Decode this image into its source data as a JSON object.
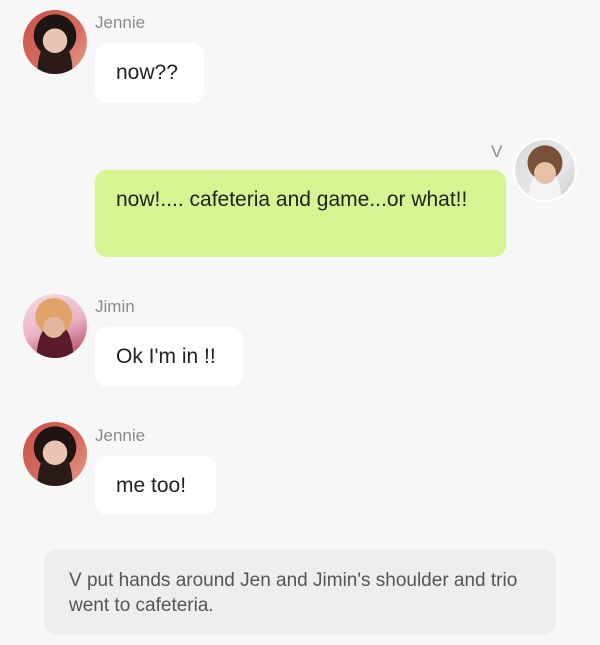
{
  "messages": [
    {
      "sender": "Jennie",
      "text": "now??",
      "side": "left",
      "avatar": "jennie-avatar"
    },
    {
      "sender": "V",
      "text": "now!.... cafeteria and game...or what!!",
      "side": "right",
      "avatar": "v-avatar"
    },
    {
      "sender": "Jimin",
      "text": "Ok I'm in !!",
      "side": "left",
      "avatar": "jimin-avatar"
    },
    {
      "sender": "Jennie",
      "text": "me too!",
      "side": "left",
      "avatar": "jennie-avatar"
    }
  ],
  "narration": "V put hands around Jen and Jimin's shoulder  and trio went to cafeteria.",
  "colors": {
    "background": "#f7f7f7",
    "bubble_other": "#ffffff",
    "bubble_me": "#d6f492",
    "narration_bg": "#eeeeee"
  }
}
